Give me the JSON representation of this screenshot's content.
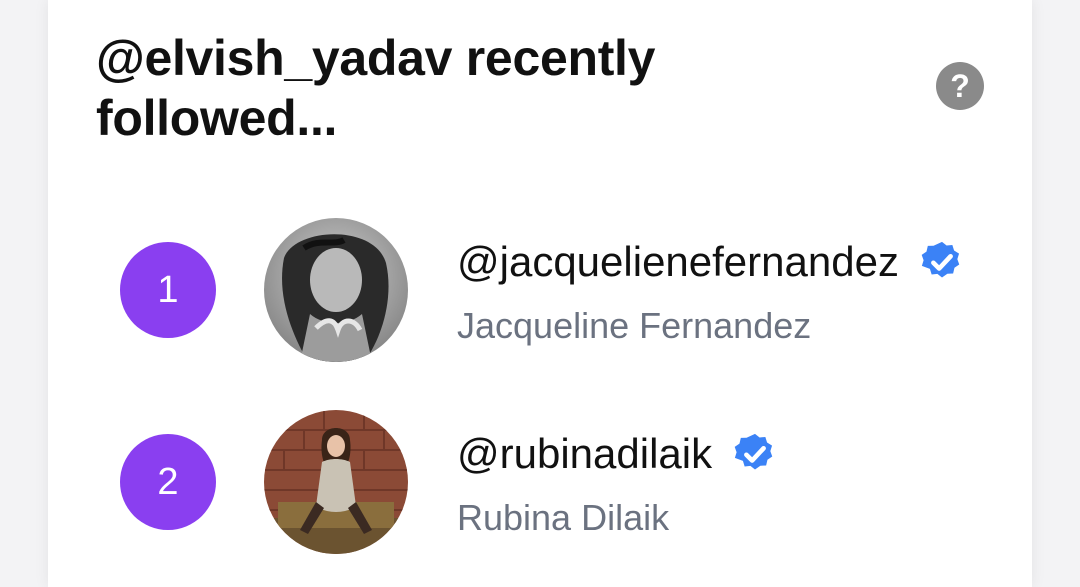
{
  "header": {
    "title": "@elvish_yadav recently followed...",
    "help_label": "?"
  },
  "colors": {
    "rank_badge": "#8a3ff0",
    "verified": "#3b82f6",
    "help_icon": "#8a8a8a",
    "secondary_text": "#6b7280"
  },
  "follows": [
    {
      "rank": "1",
      "handle": "@jacquelienefernandez",
      "name": "Jacqueline Fernandez",
      "verified": true,
      "icon": "verified-badge-icon"
    },
    {
      "rank": "2",
      "handle": "@rubinadilaik",
      "name": "Rubina Dilaik",
      "verified": true,
      "icon": "verified-badge-icon"
    }
  ]
}
